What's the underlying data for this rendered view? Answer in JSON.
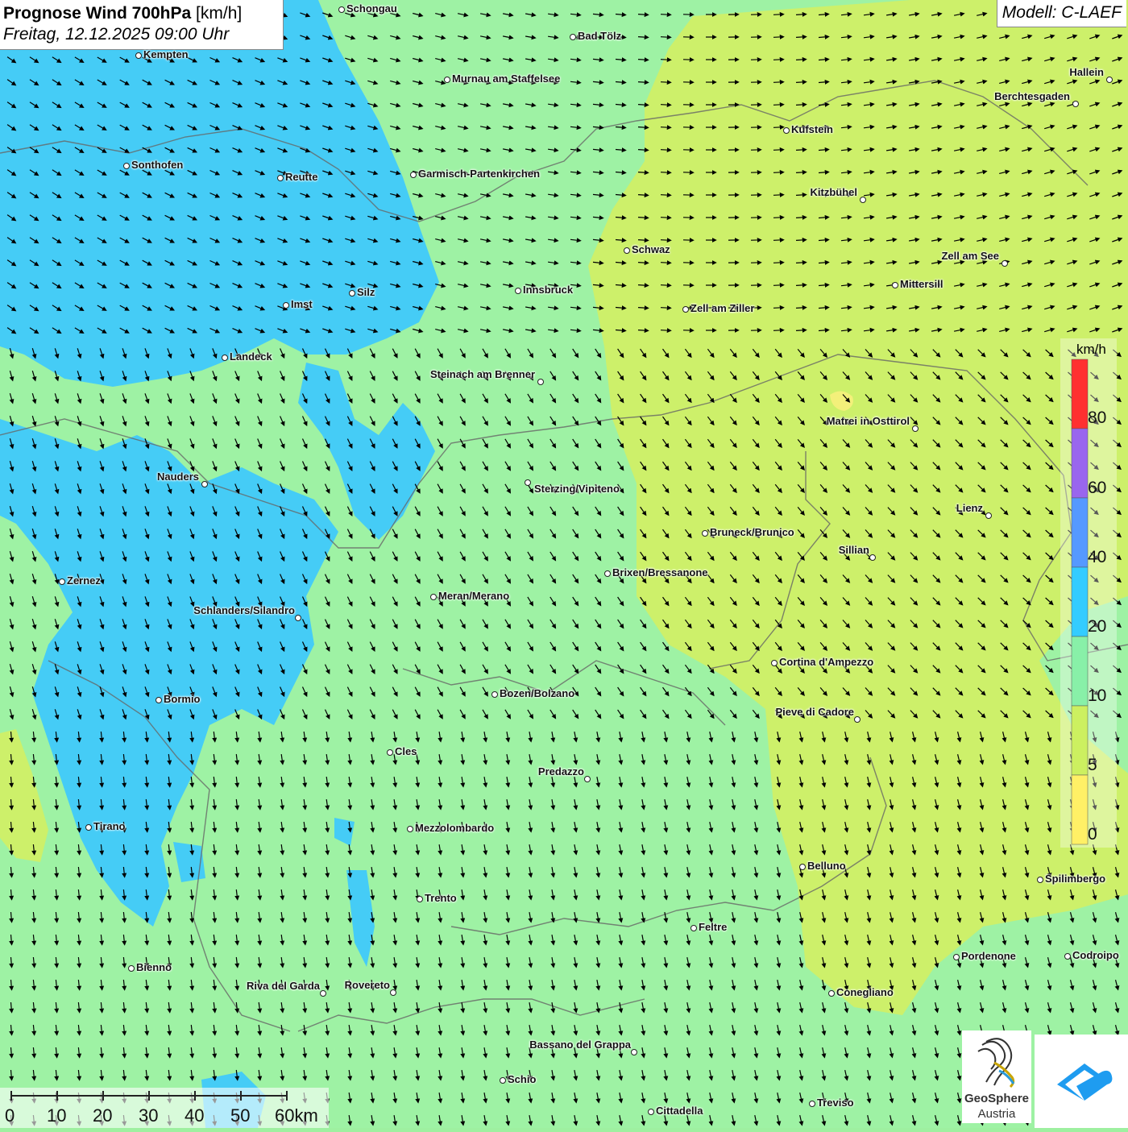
{
  "title": {
    "main": "Prognose Wind 700hPa",
    "unit": "[km/h]",
    "datetime": "Freitag, 12.12.2025 09:00 Uhr"
  },
  "model": "Modell: C-LAEF",
  "legend": {
    "unit": "km/h",
    "values": [
      "80",
      "60",
      "40",
      "20",
      "10",
      "5",
      "0"
    ],
    "colors": [
      "#ff3030",
      "#9966ee",
      "#5599ff",
      "#33ccff",
      "#88f0a8",
      "#ccf060",
      "#fff066"
    ]
  },
  "scale": {
    "labels": [
      "0",
      "10",
      "20",
      "30",
      "40",
      "50",
      "60km"
    ]
  },
  "logos": {
    "geosphere_line1": "GeoSphere",
    "geosphere_line2": "Austria"
  },
  "cities": [
    {
      "name": "Schongau"
    },
    {
      "name": "Bad Tölz"
    },
    {
      "name": "Kempten"
    },
    {
      "name": "Murnau am Staffelsee"
    },
    {
      "name": "Hallein"
    },
    {
      "name": "Berchtesgaden"
    },
    {
      "name": "Kufstein"
    },
    {
      "name": "Sonthofen"
    },
    {
      "name": "Reutte"
    },
    {
      "name": "Garmisch-Partenkirchen"
    },
    {
      "name": "Kitzbühel"
    },
    {
      "name": "Schwaz"
    },
    {
      "name": "Zell am See"
    },
    {
      "name": "Mittersill"
    },
    {
      "name": "Innsbruck"
    },
    {
      "name": "Silz"
    },
    {
      "name": "Imst"
    },
    {
      "name": "Zell am Ziller"
    },
    {
      "name": "Landeck"
    },
    {
      "name": "Steinach am Brenner"
    },
    {
      "name": "Matrei in Osttirol"
    },
    {
      "name": "Nauders"
    },
    {
      "name": "Sterzing/Vipiteno"
    },
    {
      "name": "Lienz"
    },
    {
      "name": "Bruneck/Brunico"
    },
    {
      "name": "Sillian"
    },
    {
      "name": "Zernez"
    },
    {
      "name": "Brixen/Bressanone"
    },
    {
      "name": "Meran/Merano"
    },
    {
      "name": "Schlanders/Silandro"
    },
    {
      "name": "Cortina d'Ampezzo"
    },
    {
      "name": "Bozen/Bolzano"
    },
    {
      "name": "Bormio"
    },
    {
      "name": "Pieve di Cadore"
    },
    {
      "name": "Cles"
    },
    {
      "name": "Predazzo"
    },
    {
      "name": "Tirano"
    },
    {
      "name": "Mezzolombardo"
    },
    {
      "name": "Belluno"
    },
    {
      "name": "Spilimbergo"
    },
    {
      "name": "Trento"
    },
    {
      "name": "Feltre"
    },
    {
      "name": "Bienno"
    },
    {
      "name": "Pordenone"
    },
    {
      "name": "Codroipo"
    },
    {
      "name": "Riva del Garda"
    },
    {
      "name": "Rovereto"
    },
    {
      "name": "Conegliano"
    },
    {
      "name": "Bassano del Grappa"
    },
    {
      "name": "Schio"
    },
    {
      "name": "Treviso"
    },
    {
      "name": "Cittadella"
    }
  ]
}
